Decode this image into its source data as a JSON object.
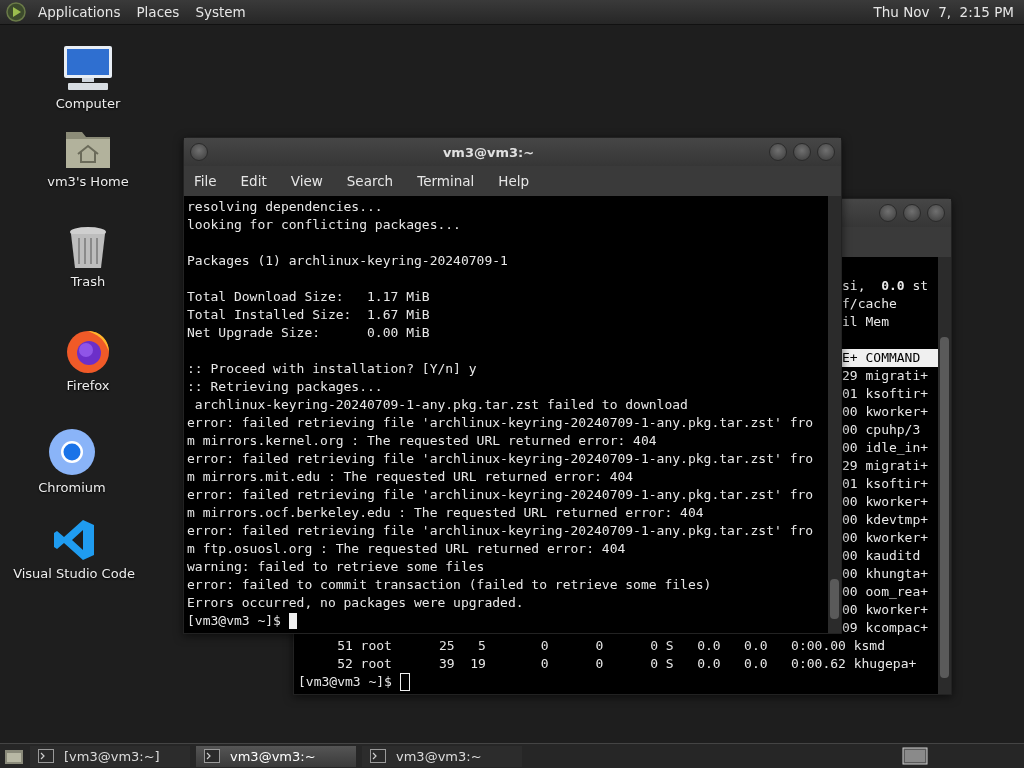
{
  "top_panel": {
    "menus": [
      "Applications",
      "Places",
      "System"
    ],
    "clock": "Thu Nov  7,  2:15 PM"
  },
  "desktop_icons": [
    {
      "label": "Computer",
      "kind": "computer"
    },
    {
      "label": "vm3's Home",
      "kind": "home"
    },
    {
      "label": "Trash",
      "kind": "trash"
    },
    {
      "label": "Firefox",
      "kind": "firefox"
    },
    {
      "label": "Chromium",
      "kind": "chromium"
    },
    {
      "label": "Visual Studio Code",
      "kind": "vscode"
    }
  ],
  "back_terminal": {
    "summary": [
      "si,  **0.0** st",
      "f/cache",
      "il Mem"
    ],
    "header": "E+ COMMAND",
    "rows": [
      "29 migrati+",
      "01 ksoftir+",
      "00 kworker+",
      "00 cpuhp/3",
      "00 idle_in+",
      "29 migrati+",
      "01 ksoftir+",
      "00 kworker+",
      "00 kdevtmp+",
      "00 kworker+",
      "00 kauditd",
      "00 khungta+",
      "00 oom_rea+",
      "00 kworker+",
      "09 kcompac+"
    ],
    "lines": [
      "     51 root      25   5       0      0      0 S   0.0   0.0   0:00.00 ksmd",
      "     52 root      39  19       0      0      0 S   0.0   0.0   0:00.62 khugepa+"
    ],
    "prompt": "[vm3@vm3 ~]$"
  },
  "front_terminal": {
    "title": "vm3@vm3:~",
    "menu": [
      "File",
      "Edit",
      "View",
      "Search",
      "Terminal",
      "Help"
    ],
    "blocks": [
      [
        "resolving dependencies...",
        "looking for conflicting packages..."
      ],
      [
        "Packages (1) archlinux-keyring-20240709-1"
      ],
      [
        "Total Download Size:   1.17 MiB",
        "Total Installed Size:  1.67 MiB",
        "Net Upgrade Size:      0.00 MiB"
      ],
      [
        ":: Proceed with installation? [Y/n] y",
        ":: Retrieving packages...",
        " archlinux-keyring-20240709-1-any.pkg.tar.zst failed to download",
        "error: failed retrieving file 'archlinux-keyring-20240709-1-any.pkg.tar.zst' fro",
        "m mirrors.kernel.org : The requested URL returned error: 404",
        "error: failed retrieving file 'archlinux-keyring-20240709-1-any.pkg.tar.zst' fro",
        "m mirrors.mit.edu : The requested URL returned error: 404",
        "error: failed retrieving file 'archlinux-keyring-20240709-1-any.pkg.tar.zst' fro",
        "m mirrors.ocf.berkeley.edu : The requested URL returned error: 404",
        "error: failed retrieving file 'archlinux-keyring-20240709-1-any.pkg.tar.zst' fro",
        "m ftp.osuosl.org : The requested URL returned error: 404",
        "warning: failed to retrieve some files",
        "error: failed to commit transaction (failed to retrieve some files)",
        "Errors occurred, no packages were upgraded."
      ]
    ],
    "prompt": "[vm3@vm3 ~]$"
  },
  "taskbar": {
    "tasks": [
      {
        "label": "[vm3@vm3:~]",
        "selected": false
      },
      {
        "label": "vm3@vm3:~",
        "selected": true
      },
      {
        "label": "vm3@vm3:~",
        "selected": false
      }
    ]
  }
}
